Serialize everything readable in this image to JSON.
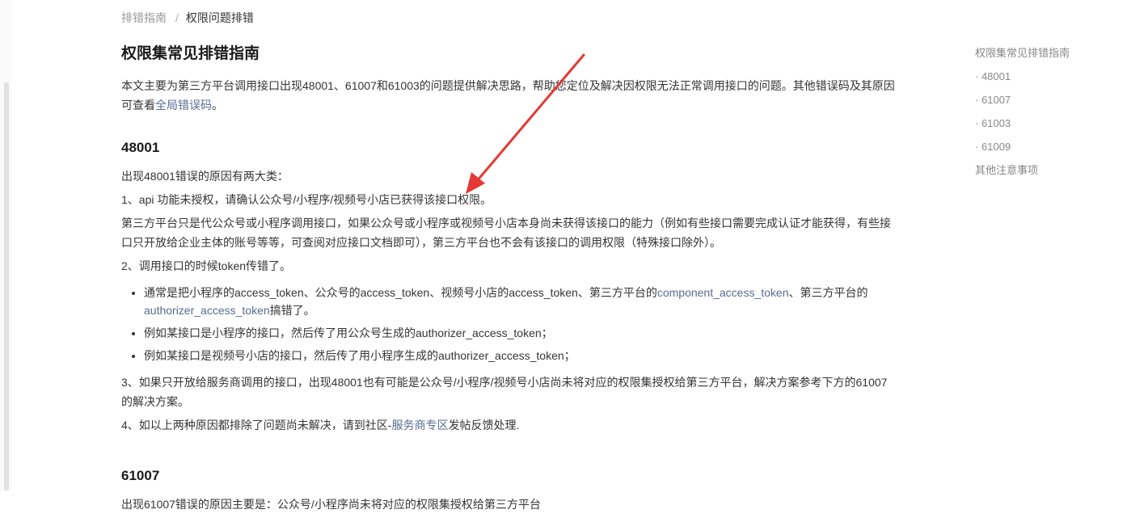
{
  "breadcrumb": {
    "parent": "排错指南",
    "separator": "/",
    "current": "权限问题排错"
  },
  "article": {
    "title": "权限集常见排错指南",
    "intro_before_link": "本文主要为第三方平台调用接口出现48001、61007和61003的问题提供解决思路，帮助您定位及解决因权限无法正常调用接口的问题。其他错误码及其原因可查看",
    "intro_link": "全局错误码",
    "intro_after_link": "。",
    "section_48001": {
      "heading": "48001",
      "lead": "出现48001错误的原因有两大类：",
      "cause1": "1、api 功能未授权，请确认公众号/小程序/视频号小店已获得该接口权限。",
      "cause1_detail": "第三方平台只是代公众号或小程序调用接口，如果公众号或小程序或视频号小店本身尚未获得该接口的能力（例如有些接口需要完成认证才能获得，有些接口只开放给企业主体的账号等等，可查阅对应接口文档即可），第三方平台也不会有该接口的调用权限（特殊接口除外）。",
      "cause2": "2、调用接口的时候token传错了。",
      "bullet1_before": "通常是把小程序的access_token、公众号的access_token、视频号小店的access_token、第三方平台的",
      "bullet1_link1": "component_access_token",
      "bullet1_mid": "、第三方平台的",
      "bullet1_link2": "authorizer_access_token",
      "bullet1_after": "搞错了。",
      "bullet2": "例如某接口是小程序的接口，然后传了用公众号生成的authorizer_access_token；",
      "bullet3": "例如某接口是视频号小店的接口，然后传了用小程序生成的authorizer_access_token；",
      "cause3": "3、如果只开放给服务商调用的接口，出现48001也有可能是公众号/小程序/视频号小店尚未将对应的权限集授权给第三方平台，解决方案参考下方的61007的解决方案。",
      "cause4_before": "4、如以上两种原因都排除了问题尚未解决，请到社区-",
      "cause4_link": "服务商专区",
      "cause4_after": "发帖反馈处理."
    },
    "section_61007": {
      "heading": "61007",
      "lead_partial": "出现61007错误的原因主要是：公众号/小程序尚未将对应的权限集授权给第三方平台"
    }
  },
  "toc": {
    "title": "权限集常见排错指南",
    "items": [
      "· 48001",
      "· 61007",
      "· 61003",
      "· 61009"
    ],
    "other": "其他注意事项"
  },
  "colors": {
    "link": "#576b95",
    "arrow": "#e53935"
  }
}
